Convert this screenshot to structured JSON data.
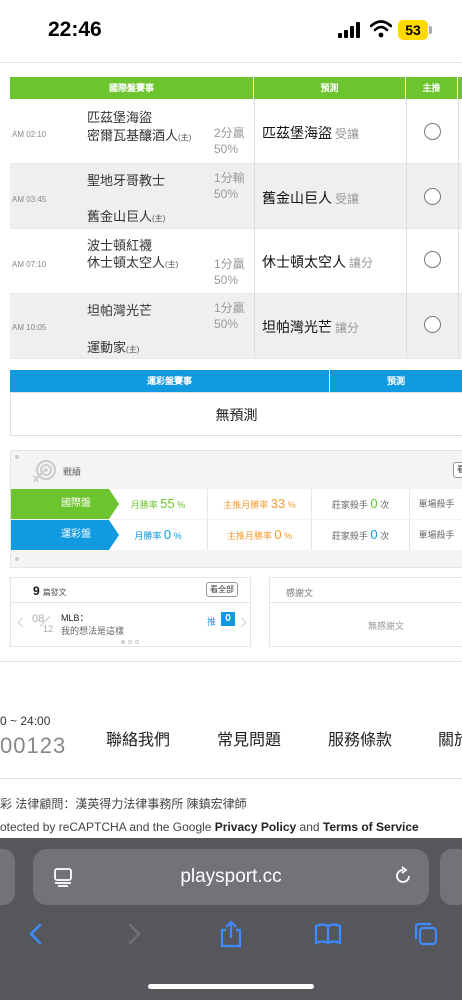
{
  "status": {
    "time": "22:46",
    "battery": "53"
  },
  "intl_table": {
    "headers": [
      "國際盤賽事",
      "預測",
      "主推"
    ],
    "games": [
      {
        "time": "AM 02:10",
        "team1": "匹茲堡海盜",
        "team2": "密爾瓦基釀酒人",
        "host": "(主)",
        "result": "2分贏",
        "pct": "50%",
        "pick": "匹茲堡海盜",
        "type": "受讓"
      },
      {
        "time": "AM 03:45",
        "team1": "聖地牙哥教士",
        "team2": "舊金山巨人",
        "host": "(主)",
        "result": "1分輸",
        "pct": "50%",
        "pick": "舊金山巨人",
        "type": "受讓"
      },
      {
        "time": "AM 07:10",
        "team1": "波士頓紅襪",
        "team2": "休士頓太空人",
        "host": "(主)",
        "result": "1分贏",
        "pct": "50%",
        "pick": "休士頓太空人",
        "type": "讓分"
      },
      {
        "time": "AM 10:05",
        "team1": "坦帕灣光芒",
        "team2": "運動家",
        "host": "(主)",
        "result": "1分贏",
        "pct": "50%",
        "pick": "坦帕灣光芒",
        "type": "讓分"
      }
    ]
  },
  "lottery_table": {
    "headers": [
      "運彩盤賽事",
      "預測"
    ],
    "empty": "無預測"
  },
  "stats": {
    "title": "戰績",
    "more": "看",
    "rows": [
      {
        "label": "國際盤",
        "color": "#6cc42e",
        "month_label": "月勝率",
        "month_val": "55",
        "main_label": "主推月勝率",
        "main_val": "33",
        "pct": "%",
        "killer_label": "莊家殺手",
        "killer_val": "0",
        "killer_unit": "次",
        "single_label": "單場殺手"
      },
      {
        "label": "運彩盤",
        "color": "#119ae0",
        "month_label": "月勝率",
        "month_val": "0",
        "main_label": "主推月勝率",
        "main_val": "0",
        "pct": "%",
        "killer_label": "莊家殺手",
        "killer_val": "0",
        "killer_unit": "次",
        "single_label": "單場殺手"
      }
    ]
  },
  "posts": {
    "count": "9",
    "count_label": "篇發文",
    "see_all": "看全部",
    "date_month": "08",
    "date_day": "12",
    "title": "MLB：",
    "subtitle": "我的想法是這樣",
    "push_label": "推",
    "push_count": "0"
  },
  "thanks": {
    "title": "感謝文",
    "empty": "無感謝文"
  },
  "footer": {
    "hours": "0 ~ 24:00",
    "phone": "00123",
    "nav": [
      "聯絡我們",
      "常見問題",
      "服務條款",
      "關於"
    ],
    "legal": "彩  法律顧問：漢英得力法律事務所  陳鎮宏律師",
    "recaptcha_pre": "otected by reCAPTCHA and the Google ",
    "privacy": "Privacy Policy",
    "and": " and ",
    "terms": "Terms of Service"
  },
  "browser": {
    "url": "playsport.cc"
  }
}
